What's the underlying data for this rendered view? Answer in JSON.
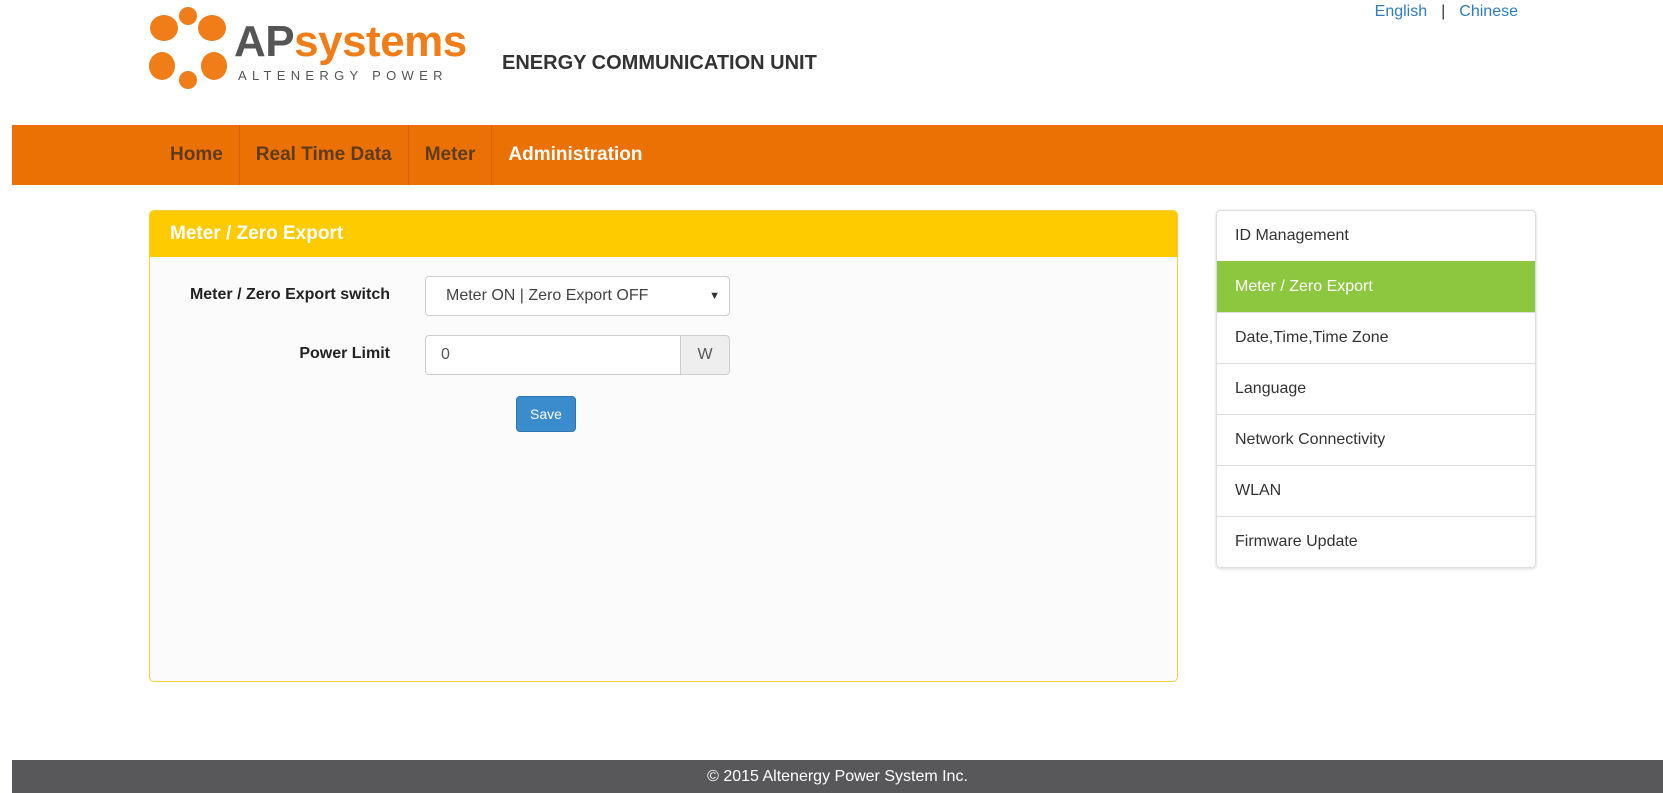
{
  "header": {
    "logo_text_ap": "AP",
    "logo_text_systems": "systems",
    "logo_tagline": "ALTENERGY POWER",
    "title": "ENERGY COMMUNICATION UNIT",
    "languages": {
      "english": "English",
      "separator": "|",
      "chinese": "Chinese"
    }
  },
  "nav": {
    "items": [
      {
        "label": "Home"
      },
      {
        "label": "Real Time Data"
      },
      {
        "label": "Meter"
      },
      {
        "label": "Administration",
        "active": true
      }
    ]
  },
  "panel": {
    "title": "Meter / Zero Export",
    "switch_label": "Meter / Zero Export switch",
    "switch_value": "Meter ON | Zero Export OFF",
    "power_limit_label": "Power Limit",
    "power_limit_value": "0",
    "power_limit_unit": "W",
    "save_label": "Save"
  },
  "sidebar": {
    "items": [
      {
        "label": "ID Management"
      },
      {
        "label": "Meter / Zero Export",
        "active": true
      },
      {
        "label": "Date,Time,Time Zone"
      },
      {
        "label": "Language"
      },
      {
        "label": "Network Connectivity"
      },
      {
        "label": "WLAN"
      },
      {
        "label": "Firmware Update"
      }
    ]
  },
  "footer": {
    "text": "© 2015 Altenergy Power System Inc."
  },
  "colors": {
    "brand_orange": "#ec7104",
    "panel_yellow": "#fecb00",
    "active_green": "#8dc63f",
    "button_blue": "#3b8ccd",
    "footer_gray": "#58585a"
  },
  "icons": {
    "dropdown": "caret-down-icon"
  }
}
